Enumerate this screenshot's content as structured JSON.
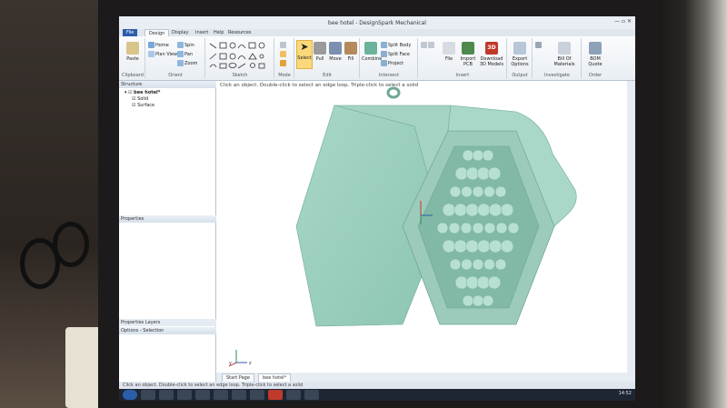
{
  "app": {
    "title": "bee hotel - DesignSpark Mechanical"
  },
  "tabs": [
    "File",
    "Design",
    "Display",
    "Insert",
    "Help",
    "Resources"
  ],
  "ribbon": {
    "clipboard": {
      "label": "Clipboard",
      "paste": "Paste"
    },
    "orient": {
      "label": "Orient",
      "home": "Home",
      "spin": "Spin",
      "plan_view": "Plan View",
      "pan": "Pan",
      "zoom": "Zoom"
    },
    "sketch": {
      "label": "Sketch"
    },
    "mode": {
      "label": "Mode"
    },
    "edit": {
      "label": "Edit",
      "select": "Select",
      "pull": "Pull",
      "move": "Move",
      "fill": "Fill"
    },
    "intersect": {
      "label": "Intersect",
      "combine": "Combine",
      "split_body": "Split Body",
      "split_face": "Split Face",
      "project": "Project"
    },
    "insert": {
      "label": "Insert",
      "file": "File",
      "import_pcb": "Import PCB",
      "download_3d": "Download 3D Models"
    },
    "output": {
      "label": "Output",
      "export": "Export Options"
    },
    "investigate": {
      "label": "Investigate",
      "bom": "Bill Of Materials"
    },
    "order": {
      "label": "Order",
      "bom_quote": "BOM Quote"
    }
  },
  "structure": {
    "header": "Structure",
    "root": "bee hotel*",
    "items": [
      "Solid",
      "Surface"
    ]
  },
  "properties": {
    "header": "Properties"
  },
  "panel_tabs": {
    "properties_layers": "Properties  Layers",
    "options": "Options - Selection"
  },
  "viewport": {
    "hint": "Click an object. Double-click to select an edge loop. Triple-click to select a solid",
    "axis_y": "y",
    "axis_z": "z"
  },
  "doc_tabs": [
    "Start Page",
    "bee hotel*"
  ],
  "status": {
    "text": "Click an object. Double-click to select an edge loop. Triple-click to select a solid"
  },
  "taskbar": {
    "clock": "14:52"
  },
  "colors": {
    "model": "#9fcfc0",
    "model_dark": "#6ea896",
    "ribbon_blue": "#2b5ea8"
  }
}
